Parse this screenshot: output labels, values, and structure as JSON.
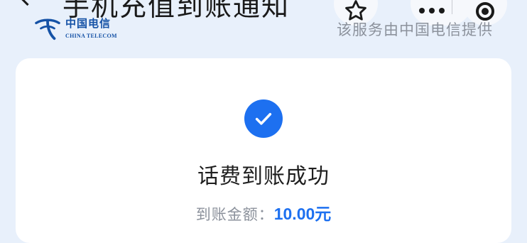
{
  "header": {
    "title": "手机充值到账通知",
    "back_icon": "chevron-left-icon",
    "star_icon": "star-outline-icon",
    "more_icon": "more-dots-icon",
    "record_icon": "record-circle-icon"
  },
  "logo": {
    "name_cn": "中国电信",
    "name_en": "CHINA TELECOM",
    "color": "#1552a6"
  },
  "provider_note": "该服务由中国电信提供",
  "card": {
    "status_icon": "check-circle-icon",
    "status_title": "话费到账成功",
    "amount_label": "到账金额：",
    "amount_value": "10.00元",
    "accent_color": "#1d70f0"
  }
}
